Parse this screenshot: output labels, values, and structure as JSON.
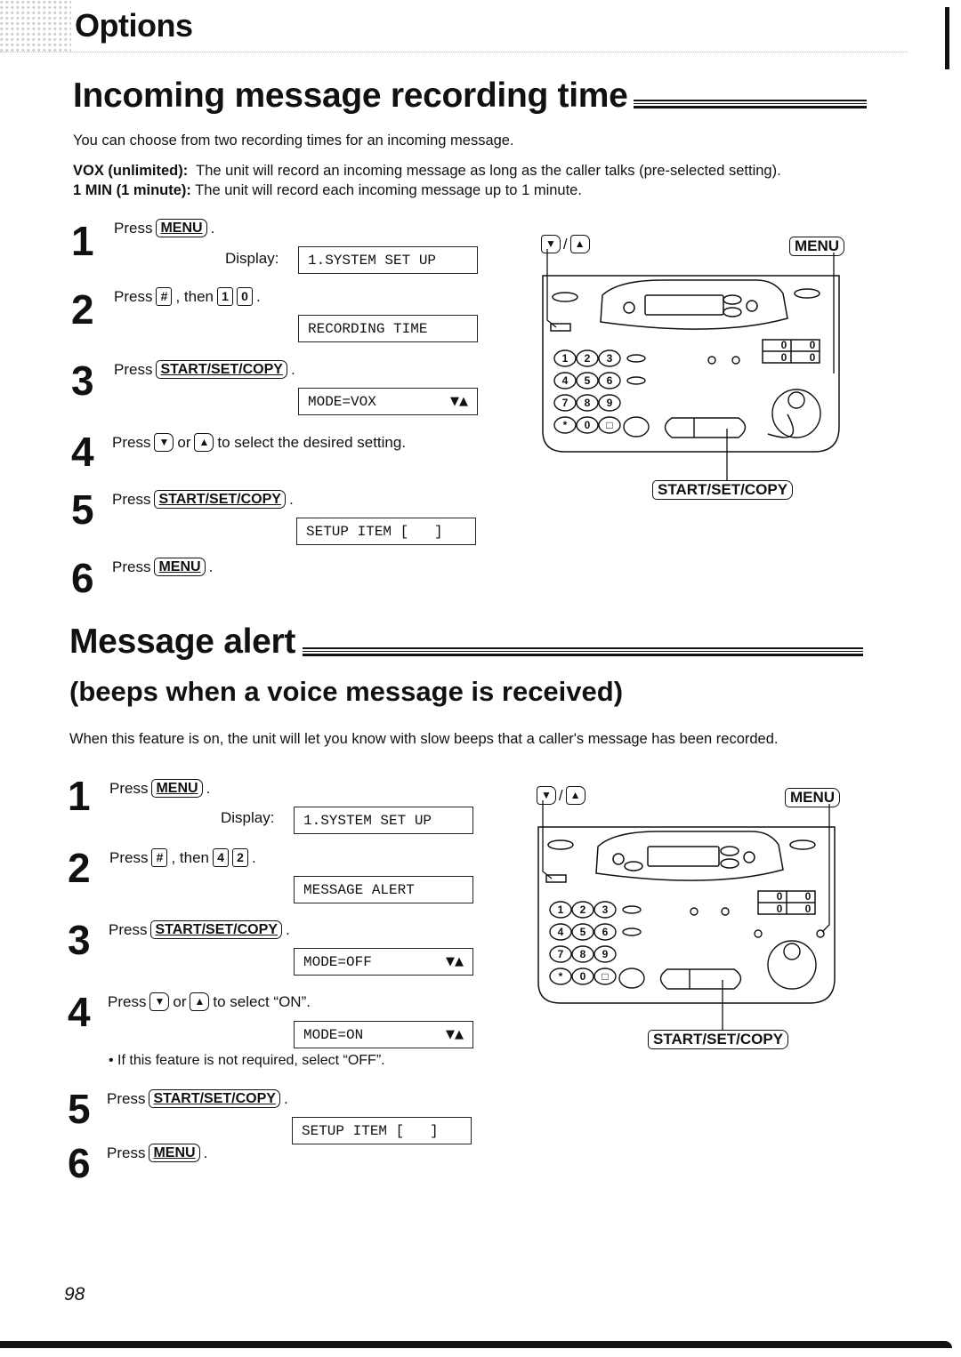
{
  "header": {
    "title": "Options"
  },
  "section1": {
    "title": "Incoming message recording time",
    "intro": "You can choose from two recording times for an incoming message.",
    "options": [
      {
        "label": "VOX (unlimited):",
        "text": "The unit will record an incoming message as long as the caller talks (pre-selected setting)."
      },
      {
        "label": "1 MIN (1 minute):",
        "text": "The unit will record each incoming message up to 1 minute."
      }
    ],
    "steps": [
      {
        "num": "1",
        "press": "Press",
        "key": "MENU",
        "display_label": "Display:",
        "display": "1.SYSTEM SET UP"
      },
      {
        "num": "2",
        "press": "Press",
        "key": "#",
        "then": ", then",
        "keys": [
          "1",
          "0"
        ],
        "display": "RECORDING TIME"
      },
      {
        "num": "3",
        "press": "Press",
        "key": "START/SET/COPY",
        "display": "MODE=VOX",
        "display_arrows": "▼▲"
      },
      {
        "num": "4",
        "press": "Press",
        "key_down": "▼",
        "or": "or",
        "key_up": "▲",
        "text": "to select the desired setting."
      },
      {
        "num": "5",
        "press": "Press",
        "key": "START/SET/COPY",
        "display": "SETUP ITEM [   ]"
      },
      {
        "num": "6",
        "press": "Press",
        "key": "MENU"
      }
    ],
    "figure": {
      "arrows_down": "▼",
      "arrows_sep": "/",
      "arrows_up": "▲",
      "menu": "MENU",
      "start": "START/SET/COPY"
    }
  },
  "section2": {
    "title": "Message alert",
    "subtitle": "(beeps when a voice message is received)",
    "intro": "When this feature is on, the unit will let you know with slow beeps that a caller's message has been recorded.",
    "steps": [
      {
        "num": "1",
        "press": "Press",
        "key": "MENU",
        "display_label": "Display:",
        "display": "1.SYSTEM SET UP"
      },
      {
        "num": "2",
        "press": "Press",
        "key": "#",
        "then": ", then",
        "keys": [
          "4",
          "2"
        ],
        "display": "MESSAGE ALERT"
      },
      {
        "num": "3",
        "press": "Press",
        "key": "START/SET/COPY",
        "display": "MODE=OFF",
        "display_arrows": "▼▲"
      },
      {
        "num": "4",
        "press": "Press",
        "key_down": "▼",
        "or": "or",
        "key_up": "▲",
        "text": "to select “ON”.",
        "display": "MODE=ON",
        "display_arrows": "▼▲",
        "note": "• If this feature is not required, select “OFF”."
      },
      {
        "num": "5",
        "press": "Press",
        "key": "START/SET/COPY",
        "display": "SETUP ITEM [   ]"
      },
      {
        "num": "6",
        "press": "Press",
        "key": "MENU"
      }
    ],
    "figure": {
      "arrows_down": "▼",
      "arrows_sep": "/",
      "arrows_up": "▲",
      "menu": "MENU",
      "start": "START/SET/COPY"
    }
  },
  "device": {
    "keypad": [
      "1",
      "2",
      "3",
      "4",
      "5",
      "6",
      "7",
      "8",
      "9",
      "*",
      "0",
      "□"
    ],
    "counter": [
      "0",
      "0",
      "0",
      "0"
    ]
  },
  "footer": {
    "page_number": "98"
  }
}
